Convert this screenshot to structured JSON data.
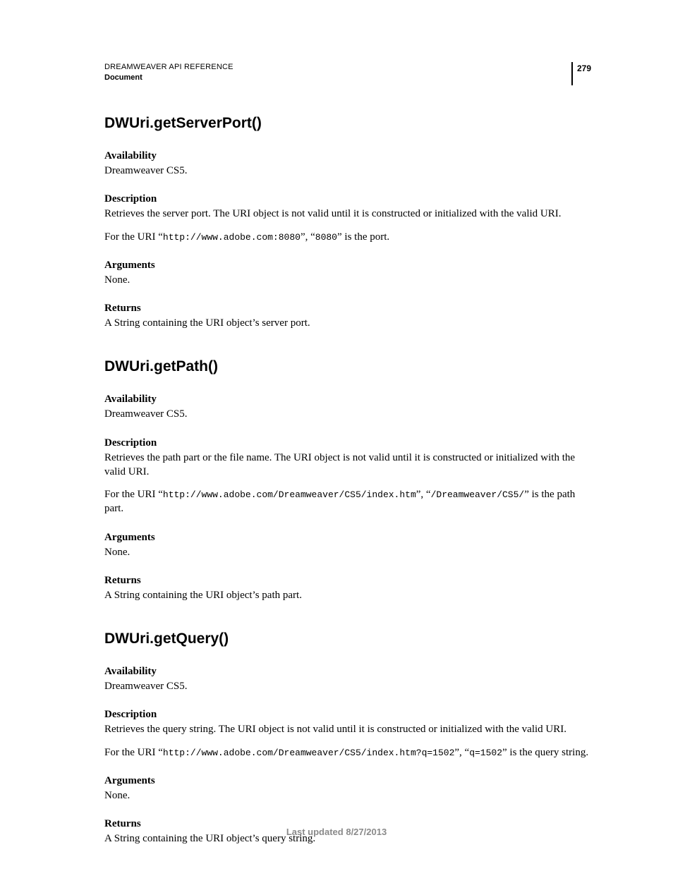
{
  "header": {
    "title": "DREAMWEAVER API REFERENCE",
    "section": "Document",
    "page_number": "279"
  },
  "functions": [
    {
      "name": "DWUri.getServerPort()",
      "availability_label": "Availability",
      "availability_value": "Dreamweaver CS5.",
      "description_label": "Description",
      "description_line1": "Retrieves the server port. The URI object is not valid until it is constructed or initialized with the valid URI.",
      "description_line2_prefix": "For the URI “",
      "description_line2_code1": "http://www.adobe.com:8080",
      "description_line2_mid": "”, “",
      "description_line2_code2": "8080",
      "description_line2_suffix": "” is the port.",
      "arguments_label": "Arguments",
      "arguments_value": "None.",
      "returns_label": "Returns",
      "returns_value": "A String containing the URI object’s server port."
    },
    {
      "name": "DWUri.getPath()",
      "availability_label": "Availability",
      "availability_value": "Dreamweaver CS5.",
      "description_label": "Description",
      "description_line1": "Retrieves the path part or the file name. The URI object is not valid until it is constructed or initialized with the valid URI.",
      "description_line2_prefix": "For the URI “",
      "description_line2_code1": "http://www.adobe.com/Dreamweaver/CS5/index.htm",
      "description_line2_mid": "”, “",
      "description_line2_code2": "/Dreamweaver/CS5/",
      "description_line2_suffix": "” is the path part.",
      "arguments_label": "Arguments",
      "arguments_value": "None.",
      "returns_label": "Returns",
      "returns_value": "A String containing the URI object’s path part."
    },
    {
      "name": "DWUri.getQuery()",
      "availability_label": "Availability",
      "availability_value": "Dreamweaver CS5.",
      "description_label": "Description",
      "description_line1": "Retrieves the query string. The URI object is not valid until it is constructed or initialized with the valid URI.",
      "description_line2_prefix": "For the URI “",
      "description_line2_code1": "http://www.adobe.com/Dreamweaver/CS5/index.htm?q=1502",
      "description_line2_mid": "”, “",
      "description_line2_code2": "q=1502",
      "description_line2_suffix": "” is the query string.",
      "arguments_label": "Arguments",
      "arguments_value": "None.",
      "returns_label": "Returns",
      "returns_value": "A String containing the URI object’s query string."
    }
  ],
  "footer": "Last updated 8/27/2013"
}
